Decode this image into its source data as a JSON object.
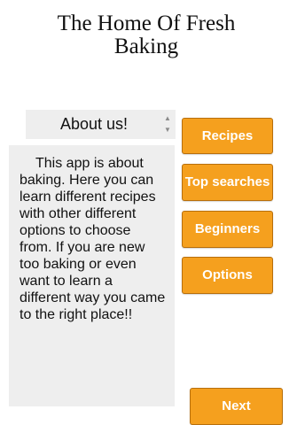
{
  "header": {
    "title": "The Home Of Fresh Baking"
  },
  "about": {
    "selected": "About us!",
    "text": "This app is about baking. Here you can learn different recipes with other different options to choose from. If you are new too baking or even want to learn a different way you came to the right place!!"
  },
  "nav": {
    "recipes": "Recipes",
    "top_searches": "Top searches",
    "beginners": "Beginners",
    "options": "Options"
  },
  "footer": {
    "next": "Next"
  },
  "colors": {
    "button": "#f5a01e",
    "button_border": "#b76f0d",
    "panel": "#eeeeee"
  },
  "icons": {
    "spinner_up": "chevron-up-icon",
    "spinner_down": "chevron-down-icon"
  }
}
